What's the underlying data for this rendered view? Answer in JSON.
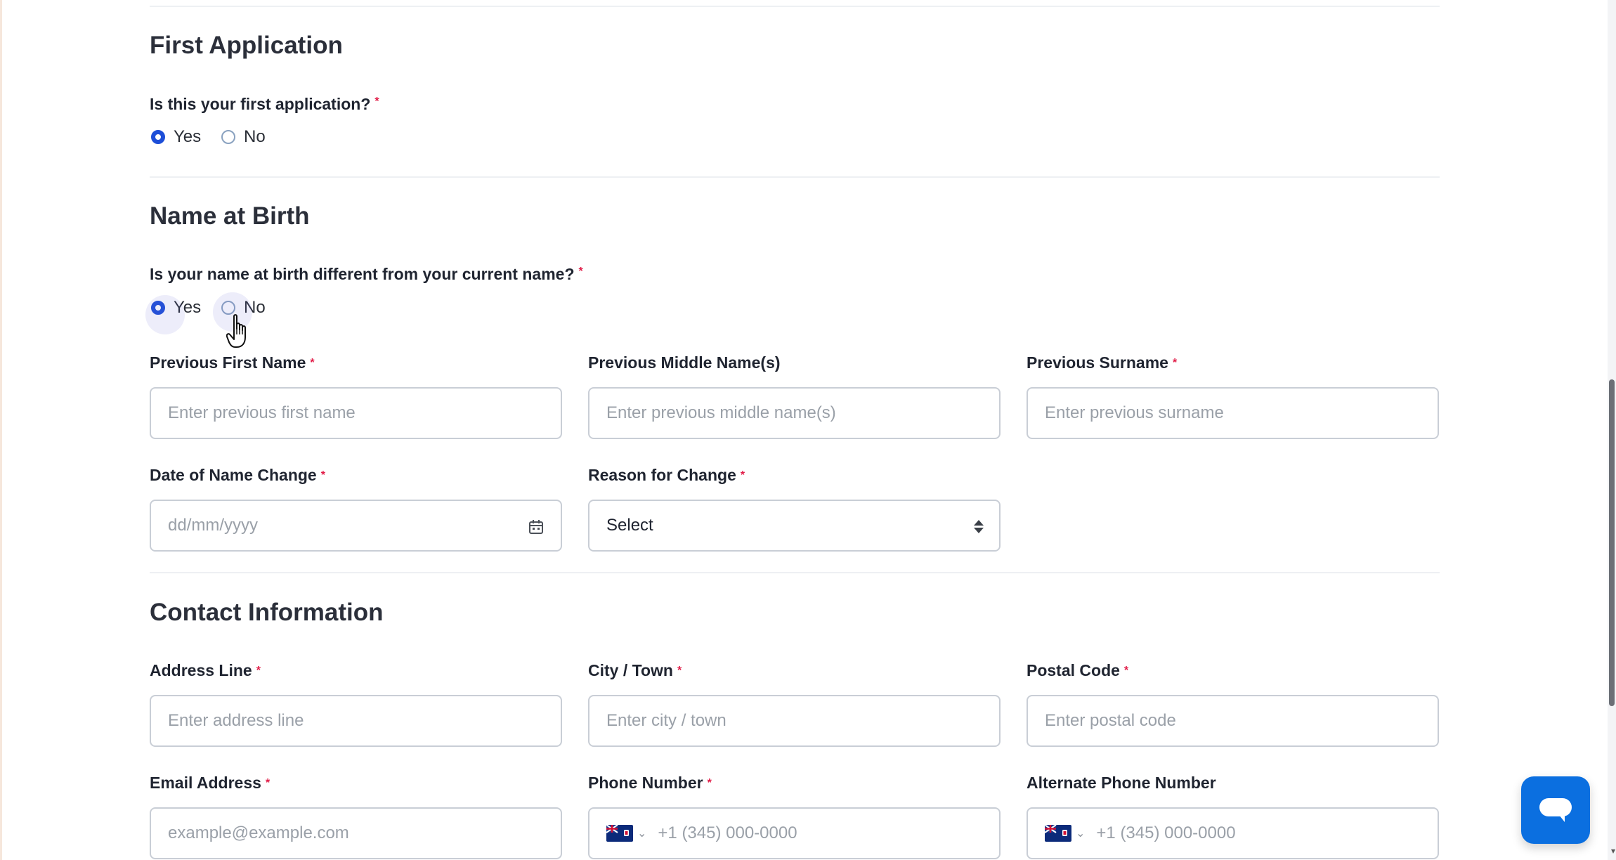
{
  "sections": {
    "first_application": {
      "title": "First Application",
      "question": "Is this your first application?",
      "required_mark": "*",
      "options": [
        "Yes",
        "No"
      ],
      "selected": "Yes"
    },
    "name_at_birth": {
      "title": "Name at Birth",
      "question": "Is your name at birth different from your current name?",
      "required_mark": "*",
      "options": [
        "Yes",
        "No"
      ],
      "selected": "Yes",
      "fields": {
        "previous_first_name": {
          "label": "Previous First Name",
          "required": "*",
          "placeholder": "Enter previous first name",
          "value": ""
        },
        "previous_middle_names": {
          "label": "Previous Middle Name(s)",
          "placeholder": "Enter previous middle name(s)",
          "value": ""
        },
        "previous_surname": {
          "label": "Previous Surname",
          "required": "*",
          "placeholder": "Enter previous surname",
          "value": ""
        },
        "date_of_name_change": {
          "label": "Date of Name Change",
          "required": "*",
          "placeholder": "dd/mm/yyyy",
          "value": ""
        },
        "reason_for_change": {
          "label": "Reason for Change",
          "required": "*",
          "selected": "Select"
        }
      }
    },
    "contact_information": {
      "title": "Contact Information",
      "fields": {
        "address_line": {
          "label": "Address Line",
          "required": "*",
          "placeholder": "Enter address line",
          "value": ""
        },
        "city_town": {
          "label": "City / Town",
          "required": "*",
          "placeholder": "Enter city / town",
          "value": ""
        },
        "postal_code": {
          "label": "Postal Code",
          "required": "*",
          "placeholder": "Enter postal code",
          "value": ""
        },
        "email_address": {
          "label": "Email Address",
          "required": "*",
          "placeholder": "example@example.com",
          "value": ""
        },
        "phone_number": {
          "label": "Phone Number",
          "required": "*",
          "placeholder": "+1 (345) 000-0000",
          "value": ""
        },
        "alternate_phone_number": {
          "label": "Alternate Phone Number",
          "placeholder": "+1 (345) 000-0000",
          "value": ""
        }
      }
    }
  },
  "icons": {
    "calendar": "calendar-icon",
    "select_arrows": "sort-arrows-icon",
    "flag": "cayman-islands-flag-icon",
    "chat": "chat-bubble-icon",
    "cursor": "hand-pointer-cursor-icon"
  },
  "colors": {
    "accent": "#1d4ed8",
    "required": "#e11d48",
    "chat_button": "#0b6fe0",
    "input_border": "#c9ced6",
    "placeholder": "#9aa0a8"
  }
}
